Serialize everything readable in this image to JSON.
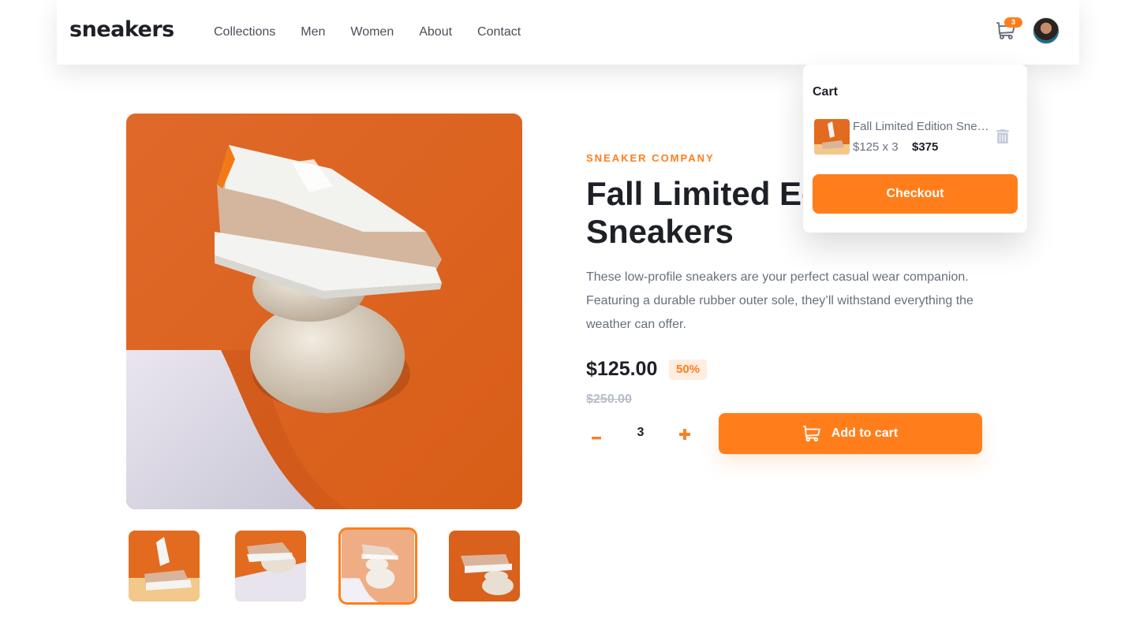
{
  "header": {
    "logo": "sneakers",
    "nav": [
      "Collections",
      "Men",
      "Women",
      "About",
      "Contact"
    ],
    "cart_count": "3",
    "cart_icon": "cart-icon",
    "avatar": "user-avatar"
  },
  "product": {
    "company": "SNEAKER COMPANY",
    "title": "Fall Limited Edition Sneakers",
    "description": "These low-profile sneakers are your perfect casual wear companion. Featuring a durable rubber outer sole, they’ll withstand everything the weather can offer.",
    "price": "$125.00",
    "discount": "50%",
    "original_price": "$250.00",
    "quantity": "3",
    "minus_label": "–",
    "plus_label": "+",
    "add_to_cart": "Add to cart",
    "active_thumbnail": 3
  },
  "cart": {
    "title": "Cart",
    "item_name": "Fall Limited Edition Sneakers",
    "item_calc": "$125 x 3",
    "item_total": "$375",
    "checkout": "Checkout"
  },
  "colors": {
    "accent": "#ff7e1b",
    "accent_pale": "#ffede0",
    "text_dark": "#1d2026",
    "text_gray": "#68707d"
  }
}
